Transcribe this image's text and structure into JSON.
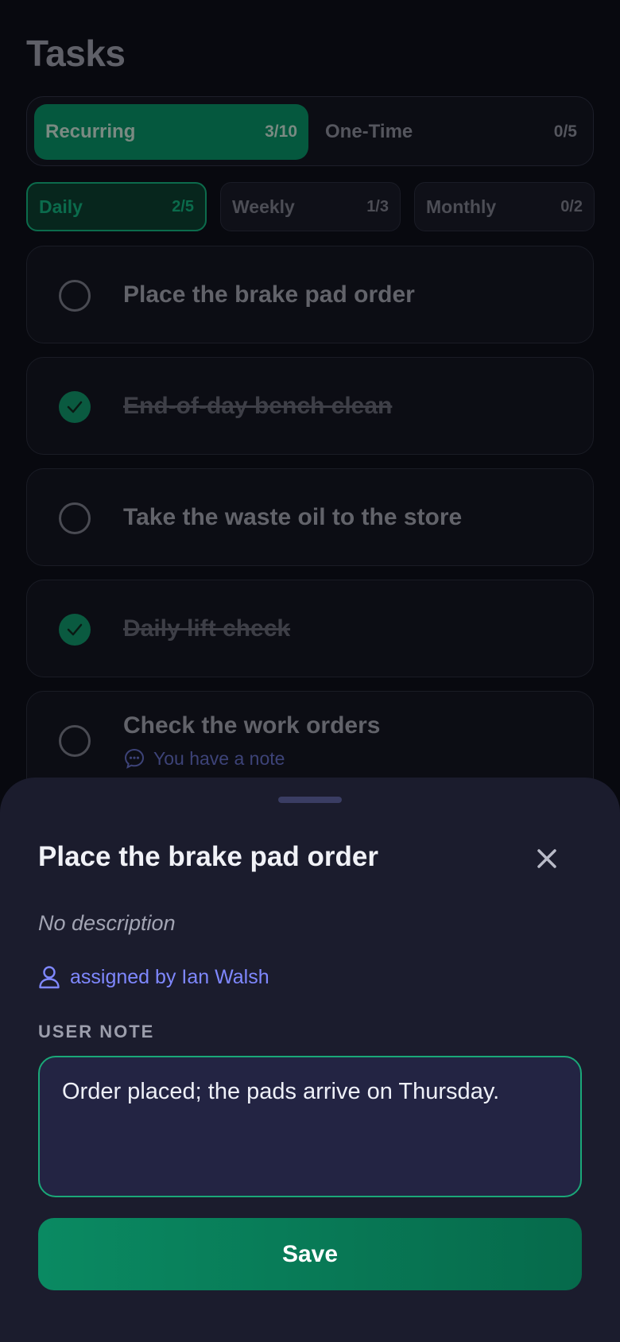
{
  "page": {
    "title": "Tasks"
  },
  "segments": [
    {
      "label": "Recurring",
      "count": "3/10",
      "active": true
    },
    {
      "label": "One-Time",
      "count": "0/5",
      "active": false
    }
  ],
  "subtabs": [
    {
      "label": "Daily",
      "count": "2/5",
      "active": true
    },
    {
      "label": "Weekly",
      "count": "1/3",
      "active": false
    },
    {
      "label": "Monthly",
      "count": "0/2",
      "active": false
    }
  ],
  "tasks": [
    {
      "label": "Place the brake pad order",
      "done": false
    },
    {
      "label": "End-of-day bench clean",
      "done": true
    },
    {
      "label": "Take the waste oil to the store",
      "done": false
    },
    {
      "label": "Daily lift check",
      "done": true
    },
    {
      "label": "Check the work orders",
      "done": false,
      "note": "You have a note"
    }
  ],
  "sheet": {
    "title": "Place the brake pad order",
    "description": "No description",
    "assigned": "assigned by Ian Walsh",
    "note_label": "USER NOTE",
    "note_value": "Order placed; the pads arrive on Thursday.",
    "save_label": "Save",
    "icons": {
      "close": "close-icon",
      "user": "user-icon"
    }
  },
  "colors": {
    "accent": "#0a8a62",
    "link": "#7f88ff",
    "input_border": "#1aa878"
  }
}
